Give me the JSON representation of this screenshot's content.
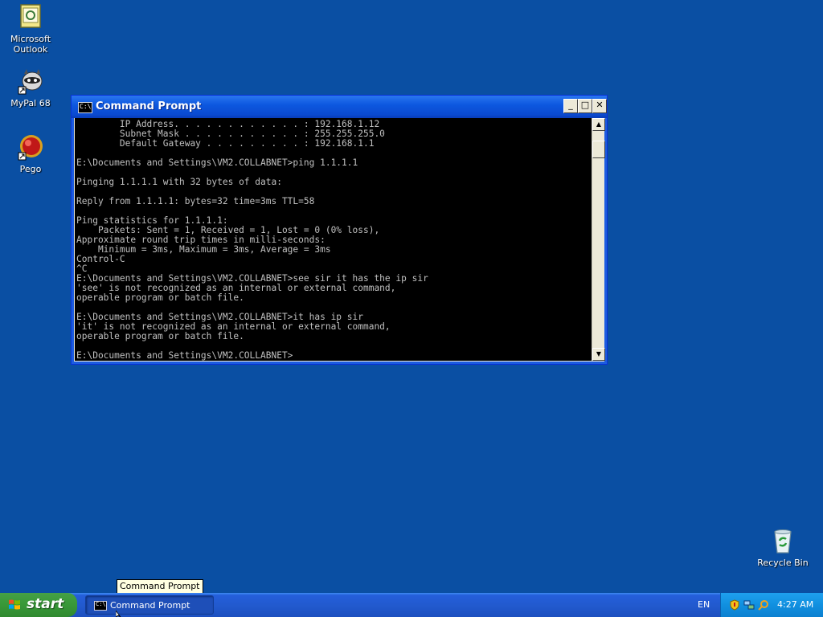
{
  "desktop": {
    "icons": [
      {
        "label": "Microsoft Outlook",
        "icon": "outlook-icon"
      },
      {
        "label": "MyPal 68",
        "icon": "mypal-raccoon-icon"
      },
      {
        "label": "Pego",
        "icon": "pego-red-ball-icon"
      },
      {
        "label": "Recycle Bin",
        "icon": "recycle-bin-icon"
      }
    ]
  },
  "window": {
    "title": "Command Prompt",
    "buttons": {
      "minimize": "_",
      "maximize": "□",
      "close": "✕"
    },
    "console_lines": [
      "        IP Address. . . . . . . . . . . . : 192.168.1.12",
      "        Subnet Mask . . . . . . . . . . . : 255.255.255.0",
      "        Default Gateway . . . . . . . . . : 192.168.1.1",
      "",
      "E:\\Documents and Settings\\VM2.COLLABNET>ping 1.1.1.1",
      "",
      "Pinging 1.1.1.1 with 32 bytes of data:",
      "",
      "Reply from 1.1.1.1: bytes=32 time=3ms TTL=58",
      "",
      "Ping statistics for 1.1.1.1:",
      "    Packets: Sent = 1, Received = 1, Lost = 0 (0% loss),",
      "Approximate round trip times in milli-seconds:",
      "    Minimum = 3ms, Maximum = 3ms, Average = 3ms",
      "Control-C",
      "^C",
      "E:\\Documents and Settings\\VM2.COLLABNET>see sir it has the ip sir",
      "'see' is not recognized as an internal or external command,",
      "operable program or batch file.",
      "",
      "E:\\Documents and Settings\\VM2.COLLABNET>it has ip sir",
      "'it' is not recognized as an internal or external command,",
      "operable program or batch file.",
      "",
      "E:\\Documents and Settings\\VM2.COLLABNET>"
    ]
  },
  "tooltip": "Command Prompt",
  "taskbar": {
    "start_label": "start",
    "task_label": "Command Prompt",
    "language": "EN",
    "clock": "4:27 AM"
  },
  "colors": {
    "desktop": "#0a4fa3",
    "console_bg": "#000000",
    "console_text": "#c0c0c0",
    "titlebar": "#0d58e0",
    "taskbar": "#225acf",
    "start_green": "#3a9a3a"
  }
}
